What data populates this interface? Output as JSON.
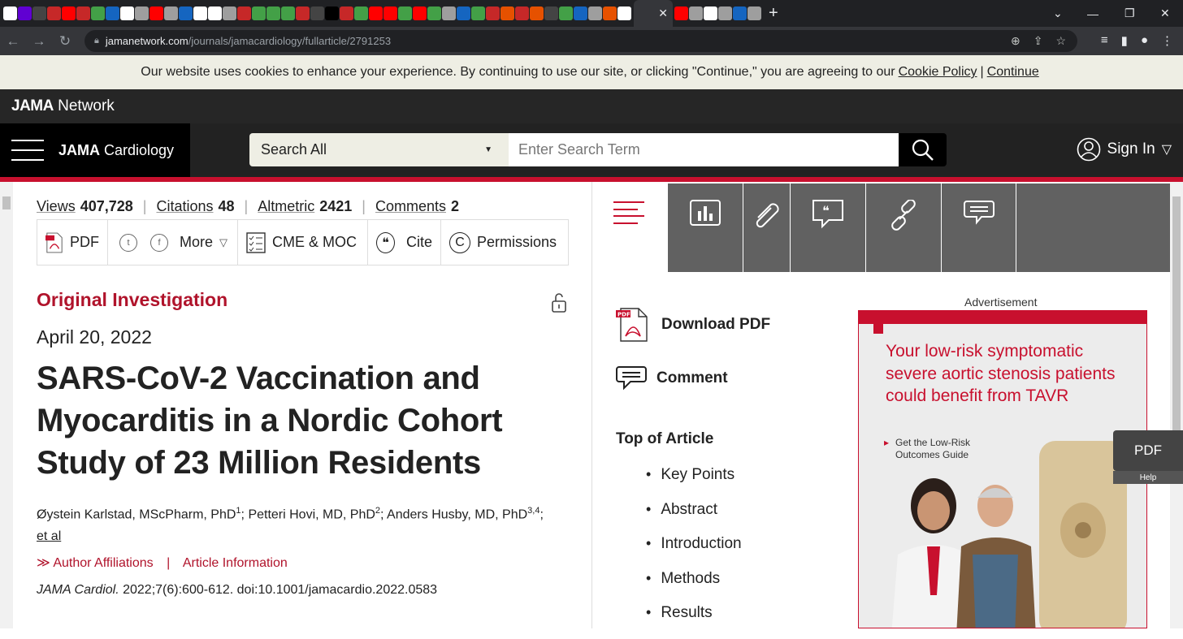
{
  "browser": {
    "url_host": "jamanetwork.com",
    "url_path": "/journals/jamacardiology/fullarticle/2791253",
    "close_tab_glyph": "✕",
    "new_tab_glyph": "+"
  },
  "cookie_banner": {
    "text": "Our website uses cookies to enhance your experience. By continuing to use our site, or clicking \"Continue,\" you are agreeing to our",
    "policy_link": "Cookie Policy",
    "separator": "|",
    "continue_link": "Continue"
  },
  "brand": {
    "network_bold": "JAMA",
    "network_rest": " Network",
    "journal_bold": "JAMA",
    "journal_rest": " Cardiology"
  },
  "search": {
    "scope": "Search All",
    "placeholder": "Enter Search Term"
  },
  "account": {
    "sign_in": "Sign In"
  },
  "metrics": {
    "views_label": "Views",
    "views": "407,728",
    "citations_label": "Citations",
    "citations": "48",
    "altmetric_label": "Altmetric",
    "altmetric": "2421",
    "comments_label": "Comments",
    "comments": "2"
  },
  "actions": {
    "pdf": "PDF",
    "more": "More",
    "cme": "CME & MOC",
    "cite": "Cite",
    "permissions": "Permissions"
  },
  "article": {
    "type": "Original Investigation",
    "date": "April 20, 2022",
    "title": "SARS-CoV-2 Vaccination and Myocarditis in a Nordic Cohort Study of 23 Million Residents",
    "author1": "Øystein Karlstad, MScPharm, PhD",
    "author1_sup": "1",
    "author2": "; Petteri Hovi, MD, PhD",
    "author2_sup": "2",
    "author3": "; Anders Husby, MD, PhD",
    "author3_sup": "3,4",
    "author_end": ";",
    "et_al": "et al",
    "affiliations": "Author Affiliations",
    "affil_sep": "|",
    "article_info": "Article Information",
    "journal_abbrev": "JAMA Cardiol.",
    "citation_rest": " 2022;7(6):600-612. doi:10.1001/jamacardio.2022.0583"
  },
  "sidebar": {
    "download_pdf": "Download PDF",
    "comment": "Comment",
    "toc_heading": "Top of Article",
    "toc_items": [
      "Key Points",
      "Abstract",
      "Introduction",
      "Methods",
      "Results"
    ]
  },
  "ad": {
    "label": "Advertisement",
    "headline": "Your low-risk symptomatic severe aortic stenosis patients could benefit from TAVR",
    "link_line1": "Get the Low-Risk",
    "link_line2": "Outcomes Guide"
  },
  "floating": {
    "pdf": "PDF",
    "help": "Help"
  },
  "colors": {
    "accent_red": "#c8102e",
    "kicker_red": "#b0132b",
    "nav_dark": "#222222"
  }
}
